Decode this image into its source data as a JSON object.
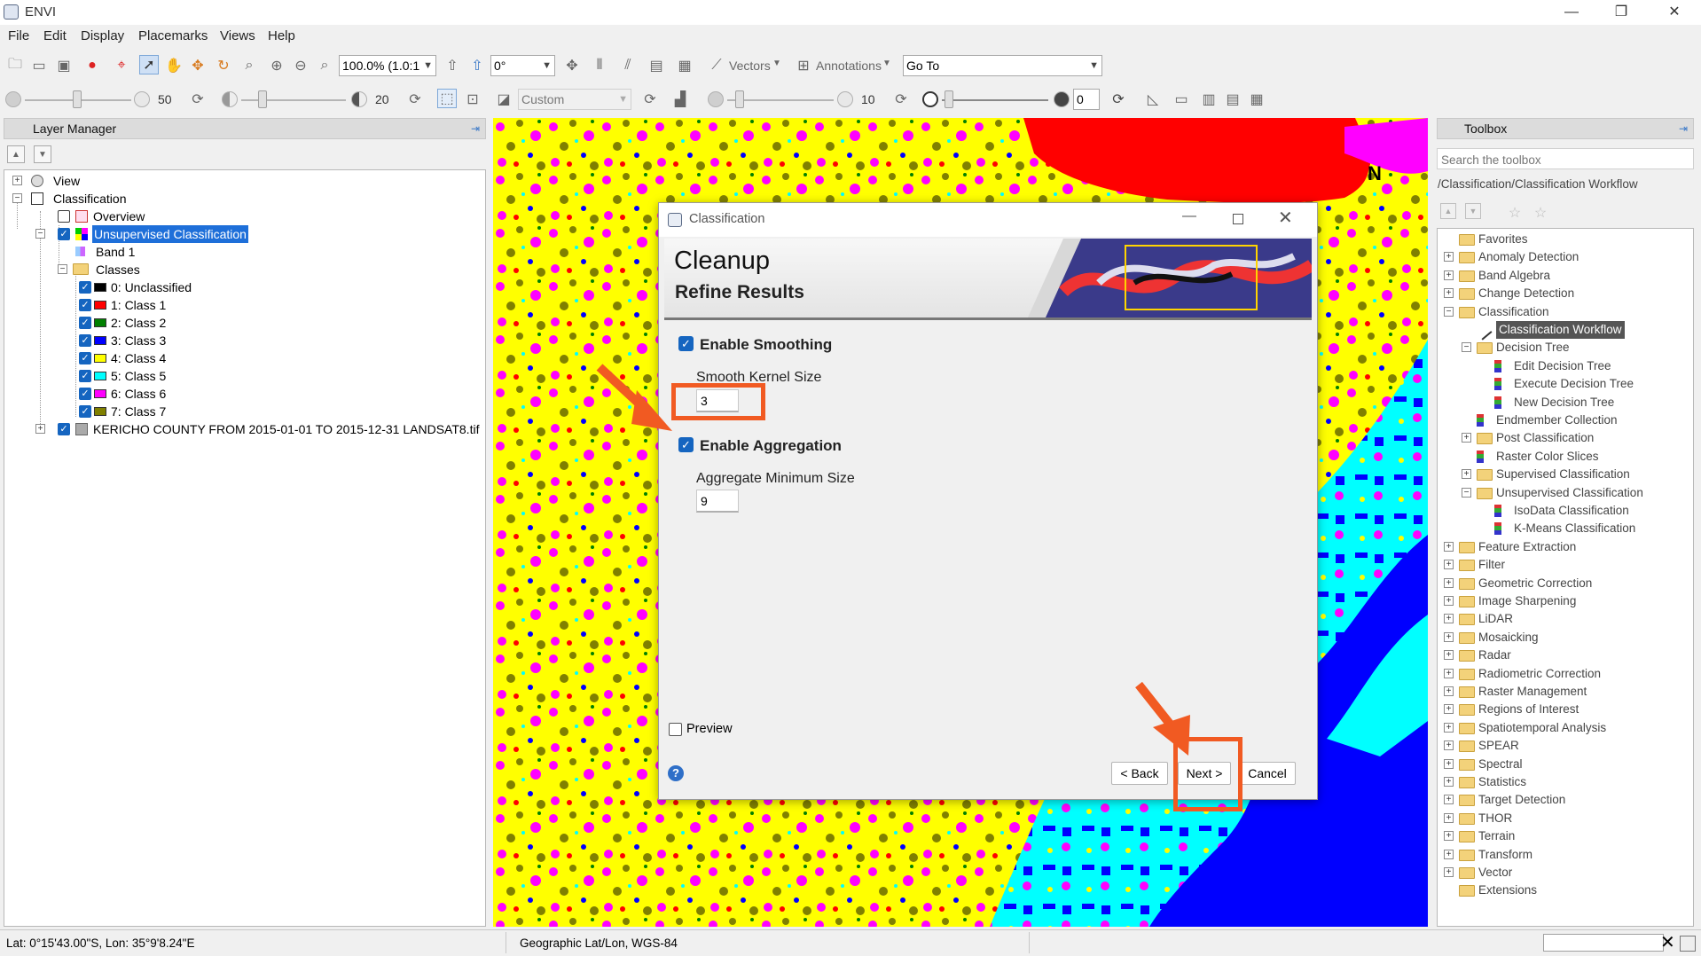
{
  "window": {
    "title": "ENVI",
    "controls": [
      "—",
      "❐",
      "✕"
    ]
  },
  "menu": [
    "File",
    "Edit",
    "Display",
    "Placemarks",
    "Views",
    "Help"
  ],
  "toolbar": {
    "zoom": "100.0% (1.0:1",
    "rotation": "0°",
    "vectors": "Vectors",
    "annotations": "Annotations",
    "goto": "Go To",
    "brightness": "50",
    "contrast": "20",
    "stretch": "Custom",
    "sharpen": "10",
    "transparency": "0"
  },
  "layer_manager": {
    "title": "Layer Manager",
    "tree": {
      "view": "View",
      "classification": "Classification",
      "overview": "Overview",
      "unsupervised": "Unsupervised Classification",
      "band": "Band 1",
      "classes_label": "Classes",
      "classes": [
        {
          "label": "0: Unclassified",
          "color": "#000000"
        },
        {
          "label": "1: Class 1",
          "color": "#ff0000"
        },
        {
          "label": "2: Class 2",
          "color": "#008000"
        },
        {
          "label": "3: Class 3",
          "color": "#0000ff"
        },
        {
          "label": "4: Class 4",
          "color": "#ffff00"
        },
        {
          "label": "5: Class 5",
          "color": "#00ffff"
        },
        {
          "label": "6: Class 6",
          "color": "#ff00ff"
        },
        {
          "label": "7: Class 7",
          "color": "#808000"
        }
      ],
      "raster": "KERICHO COUNTY FROM 2015-01-01 TO 2015-12-31 LANDSAT8.tif"
    }
  },
  "toolbox": {
    "title": "Toolbox",
    "search_placeholder": "Search the toolbox",
    "path": "/Classification/Classification Workflow",
    "items": [
      {
        "label": "Favorites",
        "kind": "folder",
        "level": 0,
        "expander": "none"
      },
      {
        "label": "Anomaly Detection",
        "kind": "folder",
        "level": 0,
        "expander": "+"
      },
      {
        "label": "Band Algebra",
        "kind": "folder",
        "level": 0,
        "expander": "+"
      },
      {
        "label": "Change Detection",
        "kind": "folder",
        "level": 0,
        "expander": "+"
      },
      {
        "label": "Classification",
        "kind": "folder",
        "level": 0,
        "expander": "-"
      },
      {
        "label": "Classification Workflow",
        "kind": "tool-selected",
        "level": 1,
        "expander": "none"
      },
      {
        "label": "Decision Tree",
        "kind": "folder",
        "level": 1,
        "expander": "-"
      },
      {
        "label": "Edit Decision Tree",
        "kind": "tool",
        "level": 2,
        "expander": "none"
      },
      {
        "label": "Execute Decision Tree",
        "kind": "tool",
        "level": 2,
        "expander": "none"
      },
      {
        "label": "New Decision Tree",
        "kind": "tool",
        "level": 2,
        "expander": "none"
      },
      {
        "label": "Endmember Collection",
        "kind": "tool",
        "level": 1,
        "expander": "none"
      },
      {
        "label": "Post Classification",
        "kind": "folder",
        "level": 1,
        "expander": "+"
      },
      {
        "label": "Raster Color Slices",
        "kind": "tool",
        "level": 1,
        "expander": "none"
      },
      {
        "label": "Supervised Classification",
        "kind": "folder",
        "level": 1,
        "expander": "+"
      },
      {
        "label": "Unsupervised Classification",
        "kind": "folder",
        "level": 1,
        "expander": "-"
      },
      {
        "label": "IsoData Classification",
        "kind": "tool",
        "level": 2,
        "expander": "none"
      },
      {
        "label": "K-Means Classification",
        "kind": "tool",
        "level": 2,
        "expander": "none"
      },
      {
        "label": "Feature Extraction",
        "kind": "folder",
        "level": 0,
        "expander": "+"
      },
      {
        "label": "Filter",
        "kind": "folder",
        "level": 0,
        "expander": "+"
      },
      {
        "label": "Geometric Correction",
        "kind": "folder",
        "level": 0,
        "expander": "+"
      },
      {
        "label": "Image Sharpening",
        "kind": "folder",
        "level": 0,
        "expander": "+"
      },
      {
        "label": "LiDAR",
        "kind": "folder",
        "level": 0,
        "expander": "+"
      },
      {
        "label": "Mosaicking",
        "kind": "folder",
        "level": 0,
        "expander": "+"
      },
      {
        "label": "Radar",
        "kind": "folder",
        "level": 0,
        "expander": "+"
      },
      {
        "label": "Radiometric Correction",
        "kind": "folder",
        "level": 0,
        "expander": "+"
      },
      {
        "label": "Raster Management",
        "kind": "folder",
        "level": 0,
        "expander": "+"
      },
      {
        "label": "Regions of Interest",
        "kind": "folder",
        "level": 0,
        "expander": "+"
      },
      {
        "label": "Spatiotemporal Analysis",
        "kind": "folder",
        "level": 0,
        "expander": "+"
      },
      {
        "label": "SPEAR",
        "kind": "folder",
        "level": 0,
        "expander": "+"
      },
      {
        "label": "Spectral",
        "kind": "folder",
        "level": 0,
        "expander": "+"
      },
      {
        "label": "Statistics",
        "kind": "folder",
        "level": 0,
        "expander": "+"
      },
      {
        "label": "Target Detection",
        "kind": "folder",
        "level": 0,
        "expander": "+"
      },
      {
        "label": "THOR",
        "kind": "folder",
        "level": 0,
        "expander": "+"
      },
      {
        "label": "Terrain",
        "kind": "folder",
        "level": 0,
        "expander": "+"
      },
      {
        "label": "Transform",
        "kind": "folder",
        "level": 0,
        "expander": "+"
      },
      {
        "label": "Vector",
        "kind": "folder",
        "level": 0,
        "expander": "+"
      },
      {
        "label": "Extensions",
        "kind": "folder",
        "level": 0,
        "expander": "none"
      }
    ]
  },
  "dialog": {
    "title": "Classification",
    "heading": "Cleanup",
    "subheading": "Refine Results",
    "smoothing": {
      "label": "Enable Smoothing",
      "checked": true,
      "field_label": "Smooth Kernel Size",
      "value": "3"
    },
    "aggregation": {
      "label": "Enable Aggregation",
      "checked": true,
      "field_label": "Aggregate Minimum Size",
      "value": "9"
    },
    "preview": "Preview",
    "help": "?",
    "buttons": {
      "back": "< Back",
      "next": "Next >",
      "cancel": "Cancel"
    }
  },
  "map_north": "N",
  "status": {
    "coords": "Lat: 0°15'43.00\"S, Lon: 35°9'8.24\"E",
    "projection": "Geographic Lat/Lon, WGS-84"
  },
  "colors": {
    "accent": "#1565c0",
    "selection": "#1e6fd9",
    "callout": "#f15a22",
    "map_yellow": "#ffff00",
    "map_magenta": "#ff00ff",
    "map_olive": "#808000",
    "map_cyan": "#00ffff",
    "map_blue": "#0000ff",
    "map_red": "#ff0000"
  }
}
